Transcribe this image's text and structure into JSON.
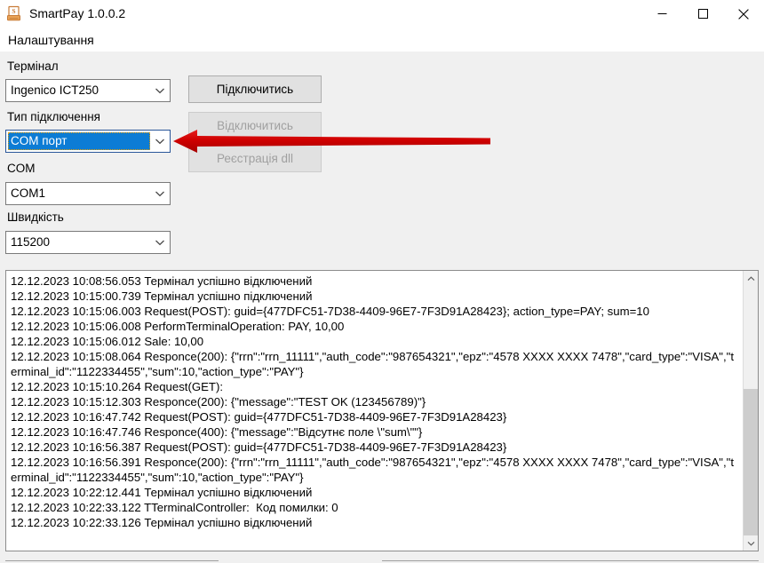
{
  "window": {
    "title": "SmartPay 1.0.0.2",
    "icon": "smartpay-app-icon",
    "minimize_label": "—",
    "maximize_label": "□",
    "close_label": "✕"
  },
  "menubar": {
    "items": [
      {
        "label": "Налаштування"
      }
    ]
  },
  "form": {
    "terminal": {
      "label": "Термінал",
      "value": "Ingenico ICT250"
    },
    "connection_type": {
      "label": "Тип підключення",
      "value": "COM порт",
      "focused": true
    },
    "com": {
      "label": "COM",
      "value": "COM1"
    },
    "speed": {
      "label": "Швидкість",
      "value": "115200"
    }
  },
  "buttons": {
    "connect": {
      "label": "Підключитись",
      "enabled": true
    },
    "disconnect": {
      "label": "Відключитись",
      "enabled": false
    },
    "register_dll": {
      "label": "Реєстрація dll",
      "enabled": false
    }
  },
  "log": {
    "lines": [
      "12.12.2023 10:08:56.053 Термінал успішно відключений",
      "12.12.2023 10:15:00.739 Термінал успішно підключений",
      "12.12.2023 10:15:06.003 Request(POST): guid={477DFC51-7D38-4409-96E7-7F3D91A28423}; action_type=PAY; sum=10",
      "12.12.2023 10:15:06.008 PerformTerminalOperation: PAY, 10,00",
      "12.12.2023 10:15:06.012 Sale: 10,00",
      "12.12.2023 10:15:08.064 Responce(200): {\"rrn\":\"rrn_11111\",\"auth_code\":\"987654321\",\"epz\":\"4578 XXXX XXXX 7478\",\"card_type\":\"VISA\",\"terminal_id\":\"1122334455\",\"sum\":10,\"action_type\":\"PAY\"}",
      "12.12.2023 10:15:10.264 Request(GET):",
      "12.12.2023 10:15:12.303 Responce(200): {\"message\":\"TEST OK (123456789)\"}",
      "12.12.2023 10:16:47.742 Request(POST): guid={477DFC51-7D38-4409-96E7-7F3D91A28423}",
      "12.12.2023 10:16:47.746 Responce(400): {\"message\":\"Відсутнє поле \\\"sum\\\"\"}",
      "12.12.2023 10:16:56.387 Request(POST): guid={477DFC51-7D38-4409-96E7-7F3D91A28423}",
      "12.12.2023 10:16:56.391 Responce(200): {\"rrn\":\"rrn_11111\",\"auth_code\":\"987654321\",\"epz\":\"4578 XXXX XXXX 7478\",\"card_type\":\"VISA\",\"terminal_id\":\"1122334455\",\"sum\":10,\"action_type\":\"PAY\"}",
      "12.12.2023 10:22:12.441 Термінал успішно відключений",
      "12.12.2023 10:22:33.122 TTerminalController:  Код помилки: 0",
      "12.12.2023 10:22:33.126 Термінал успішно відключений"
    ]
  },
  "annotation": {
    "arrow_color": "#d40000",
    "points_to": "connection-type-combobox"
  },
  "colors": {
    "selection_blue": "#0c7cd5",
    "client_background": "#f0f0f0",
    "button_face": "#e1e1e1",
    "focus_outline": "#f0a000"
  }
}
